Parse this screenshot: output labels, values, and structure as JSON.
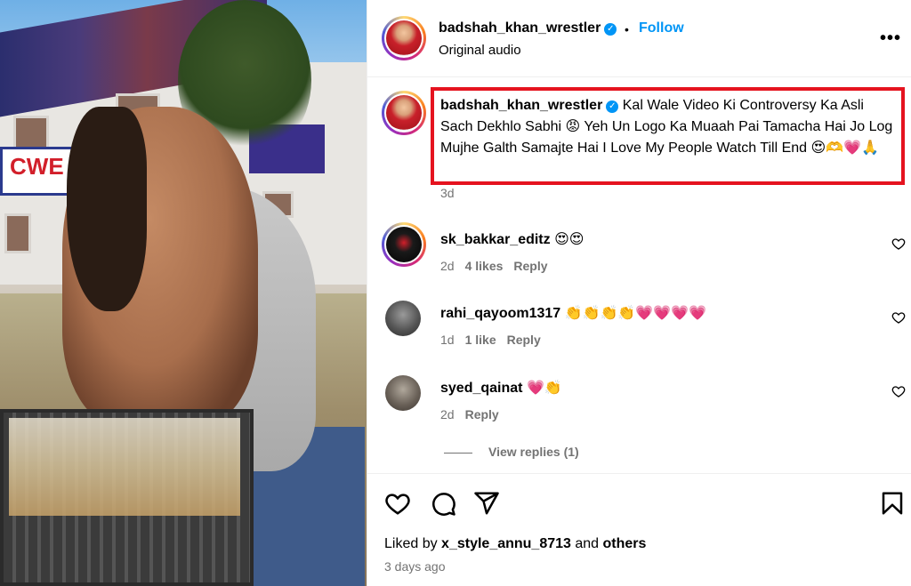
{
  "post": {
    "author": "badshah_khan_wrestler",
    "follow_label": "Follow",
    "separator": "•",
    "audio": "Original audio",
    "more_label": "•••"
  },
  "caption": {
    "author": "badshah_khan_wrestler",
    "text": "Kal Wale Video Ki Controversy Ka Asli Sach Dekhlo Sabhi 😡 Yeh Un Logo Ka Muaah Pai Tamacha Hai Jo Log Mujhe Galth Samajte Hai I Love My People Watch Till End 😍🫶💗🙏",
    "age": "3d"
  },
  "comments": [
    {
      "user": "sk_bakkar_editz",
      "text": "😍😍",
      "age": "2d",
      "likes": "4 likes",
      "reply": "Reply"
    },
    {
      "user": "rahi_qayoom1317",
      "text": "👏👏👏👏💗💗💗💗",
      "age": "1d",
      "likes": "1 like",
      "reply": "Reply"
    },
    {
      "user": "syed_qainat",
      "text": "💗👏",
      "age": "2d",
      "likes": "",
      "reply": "Reply"
    }
  ],
  "view_replies": "View replies (1)",
  "footer": {
    "liked_prefix": "Liked by",
    "liked_user": "x_style_annu_8713",
    "liked_and": "and",
    "liked_others": "others",
    "time_ago": "3 days ago"
  },
  "colors": {
    "accent": "#0095f6",
    "highlight_border": "#e5131f",
    "secondary_text": "#737373"
  },
  "icons": [
    "verified-icon",
    "more-icon",
    "heart-icon",
    "comment-icon",
    "share-icon",
    "save-icon"
  ]
}
